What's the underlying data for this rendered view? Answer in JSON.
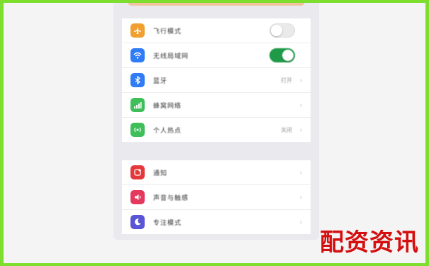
{
  "settings": {
    "group1": [
      {
        "label": "飞行模式",
        "icon": "airplane-icon",
        "icon_color": "#f0a030",
        "control": "toggle-off"
      },
      {
        "label": "无线局域网",
        "icon": "wifi-icon",
        "icon_color": "#2f7cf6",
        "control": "toggle-on"
      },
      {
        "label": "蓝牙",
        "icon": "bluetooth-icon",
        "icon_color": "#2f7cf6",
        "control": "value",
        "value": "打开"
      },
      {
        "label": "蜂窝网络",
        "icon": "cellular-icon",
        "icon_color": "#3fbf5a",
        "control": "chevron"
      },
      {
        "label": "个人热点",
        "icon": "hotspot-icon",
        "icon_color": "#3fbf5a",
        "control": "value",
        "value": "关闭"
      }
    ],
    "group2": [
      {
        "label": "通知",
        "icon": "notification-icon",
        "icon_color": "#e5383b",
        "control": "chevron"
      },
      {
        "label": "声音与触感",
        "icon": "sound-icon",
        "icon_color": "#e5385d",
        "control": "chevron"
      },
      {
        "label": "专注模式",
        "icon": "moon-icon",
        "icon_color": "#5856d6",
        "control": "chevron"
      }
    ]
  },
  "watermark": "配资资讯",
  "colors": {
    "border": "#7dde2d",
    "toggle_on": "#1f9a48",
    "watermark": "#d40f0f"
  }
}
